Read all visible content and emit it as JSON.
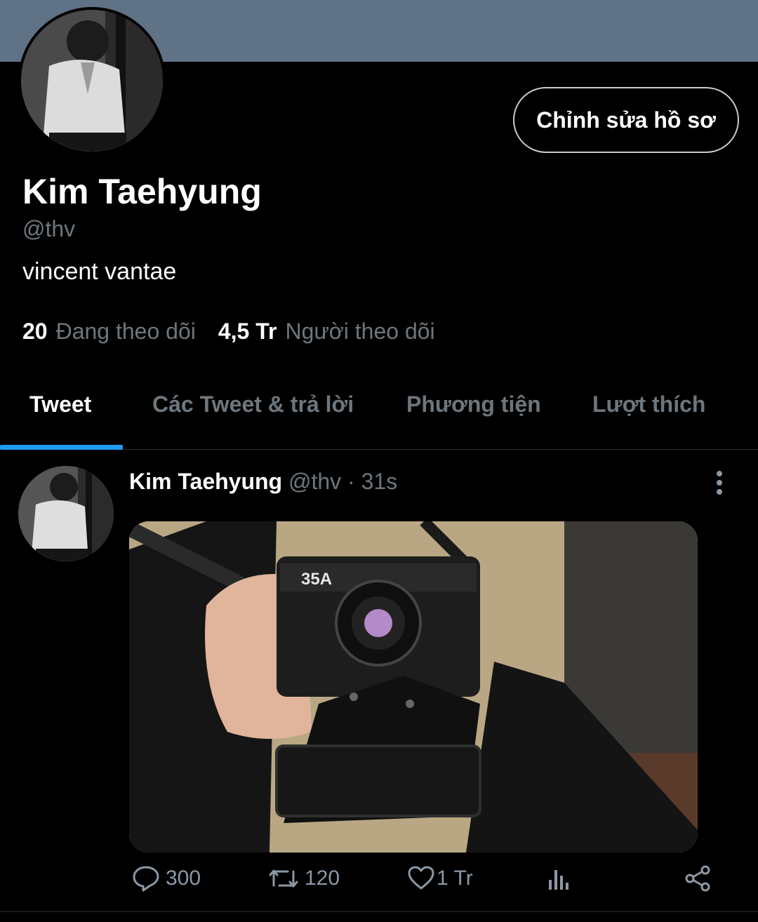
{
  "profile": {
    "edit_button": "Chỉnh sửa hồ sơ",
    "name": "Kim Taehyung",
    "handle": "@thv",
    "bio": "vincent vantae",
    "following_count": "20",
    "following_label": "Đang theo dõi",
    "followers_count": "4,5 Tr",
    "followers_label": "Người theo dõi"
  },
  "tabs": [
    {
      "label": "Tweet",
      "active": true
    },
    {
      "label": "Các Tweet & trả lời",
      "active": false
    },
    {
      "label": "Phương tiện",
      "active": false
    },
    {
      "label": "Lượt thích",
      "active": false
    }
  ],
  "tweet": {
    "author_name": "Kim Taehyung",
    "meta": "@thv · 31s",
    "camera_text": "35A",
    "replies": "300",
    "retweets": "120",
    "likes": "1 Tr"
  },
  "icons": {
    "reply": "reply-icon",
    "retweet": "retweet-icon",
    "like": "heart-icon",
    "analytics": "analytics-icon",
    "share": "share-icon",
    "more": "more-vertical-icon"
  },
  "colors": {
    "banner": "#5f7286",
    "accent": "#1d9bf0",
    "muted": "#6e767d"
  }
}
